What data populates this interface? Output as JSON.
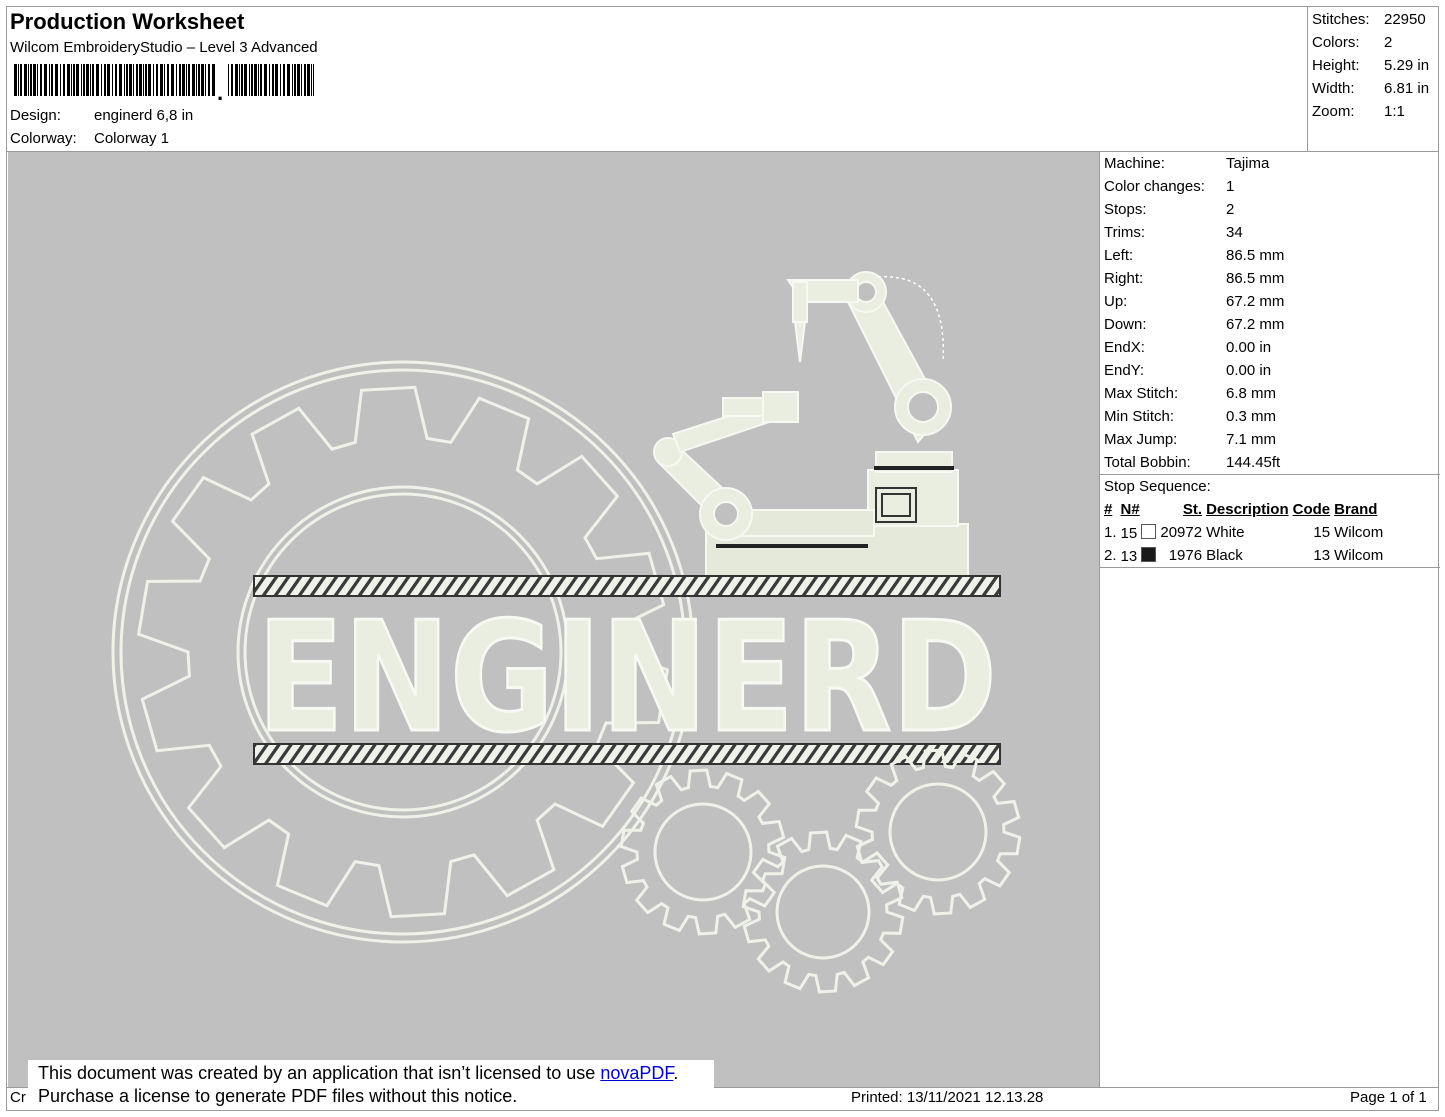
{
  "header": {
    "title": "Production Worksheet",
    "app": "Wilcom EmbroideryStudio – Level 3 Advanced",
    "design_label": "Design:",
    "design_value": "enginerd 6,8 in",
    "colorway_label": "Colorway:",
    "colorway_value": "Colorway 1"
  },
  "summary": [
    {
      "label": "Stitches:",
      "value": "22950"
    },
    {
      "label": "Colors:",
      "value": "2"
    },
    {
      "label": "Height:",
      "value": "5.29 in"
    },
    {
      "label": "Width:",
      "value": "6.81 in"
    },
    {
      "label": "Zoom:",
      "value": "1:1"
    }
  ],
  "design_art": {
    "text": "ENGINERD",
    "thread_color": "#e9eee0",
    "outline_color": "#f3f6ee",
    "background": "#c0c0c0"
  },
  "machine_info": [
    {
      "label": "Machine:",
      "value": "Tajima"
    },
    {
      "label": "Color changes:",
      "value": "1"
    },
    {
      "label": "Stops:",
      "value": "2"
    },
    {
      "label": "Trims:",
      "value": "34"
    },
    {
      "label": "Left:",
      "value": "86.5 mm"
    },
    {
      "label": "Right:",
      "value": "86.5 mm"
    },
    {
      "label": "Up:",
      "value": "67.2 mm"
    },
    {
      "label": "Down:",
      "value": "67.2 mm"
    },
    {
      "label": "EndX:",
      "value": "0.00 in"
    },
    {
      "label": "EndY:",
      "value": "0.00 in"
    },
    {
      "label": "Max Stitch:",
      "value": "6.8 mm"
    },
    {
      "label": "Min Stitch:",
      "value": "0.3 mm"
    },
    {
      "label": "Max Jump:",
      "value": "7.1 mm"
    },
    {
      "label": "Total Bobbin:",
      "value": "144.45ft"
    }
  ],
  "stop_sequence": {
    "label": "Stop Sequence:",
    "headers": [
      "#",
      "N#",
      "St.",
      "Description",
      "Code",
      "Brand"
    ],
    "rows": [
      {
        "num": "1.",
        "n": "15",
        "color": "#ffffff",
        "st": "20972",
        "desc": "White",
        "code": "15",
        "brand": "Wilcom"
      },
      {
        "num": "2.",
        "n": "13",
        "color": "#1a1a1a",
        "st": "1976",
        "desc": "Black",
        "code": "13",
        "brand": "Wilcom"
      }
    ]
  },
  "footer": {
    "left": "Cr",
    "printed": "Printed: 13/11/2021 12.13.28",
    "page": "Page 1 of 1"
  },
  "notice": {
    "line1_pre": "This document was created by an application that isn’t licensed to use ",
    "link": "novaPDF",
    "line1_post": ".",
    "line2": "Purchase a license to generate PDF files without this notice."
  }
}
